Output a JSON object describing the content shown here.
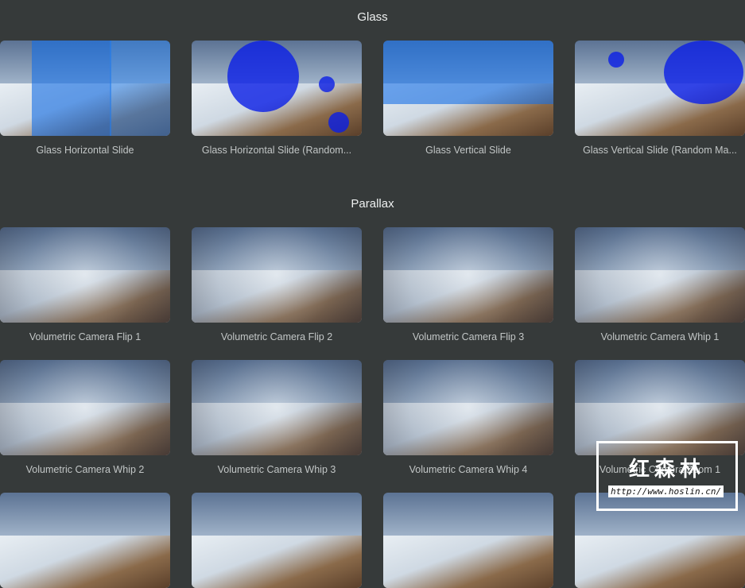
{
  "sections": [
    {
      "title": "Glass",
      "items": [
        "Glass Horizontal Slide",
        "Glass Horizontal Slide (Random...",
        "Glass Vertical Slide",
        "Glass Vertical Slide (Random Ma..."
      ]
    },
    {
      "title": "Parallax",
      "items": [
        "Volumetric Camera Flip 1",
        "Volumetric Camera Flip 2",
        "Volumetric Camera Flip 3",
        "Volumetric Camera Whip 1",
        "Volumetric Camera Whip 2",
        "Volumetric Camera Whip 3",
        "Volumetric Camera Whip 4",
        "Volumetric Camera Zoom 1"
      ]
    }
  ],
  "watermark": {
    "text": "红森林",
    "url": "http://www.hoslin.cn/"
  }
}
